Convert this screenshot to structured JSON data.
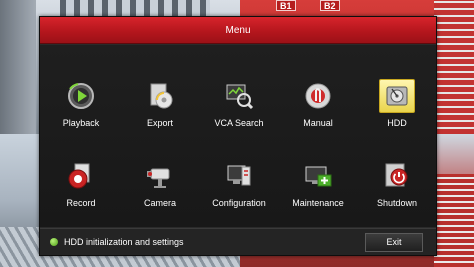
{
  "background": {
    "seat_labels": [
      "B1",
      "B2"
    ]
  },
  "menu": {
    "title": "Menu",
    "selected": "HDD",
    "items": [
      {
        "label": "Playback",
        "icon": "playback-icon"
      },
      {
        "label": "Export",
        "icon": "export-icon"
      },
      {
        "label": "VCA Search",
        "icon": "vca-search-icon"
      },
      {
        "label": "Manual",
        "icon": "manual-icon"
      },
      {
        "label": "HDD",
        "icon": "hdd-icon"
      },
      {
        "label": "Record",
        "icon": "record-icon"
      },
      {
        "label": "Camera",
        "icon": "camera-icon"
      },
      {
        "label": "Configuration",
        "icon": "configuration-icon"
      },
      {
        "label": "Maintenance",
        "icon": "maintenance-icon"
      },
      {
        "label": "Shutdown",
        "icon": "shutdown-icon"
      }
    ]
  },
  "footer": {
    "hint": "HDD initialization and settings",
    "exit_label": "Exit"
  },
  "colors": {
    "accent_red": "#c0191f",
    "panel": "#1c1c1c",
    "selected_highlight": "#e9d44c"
  }
}
